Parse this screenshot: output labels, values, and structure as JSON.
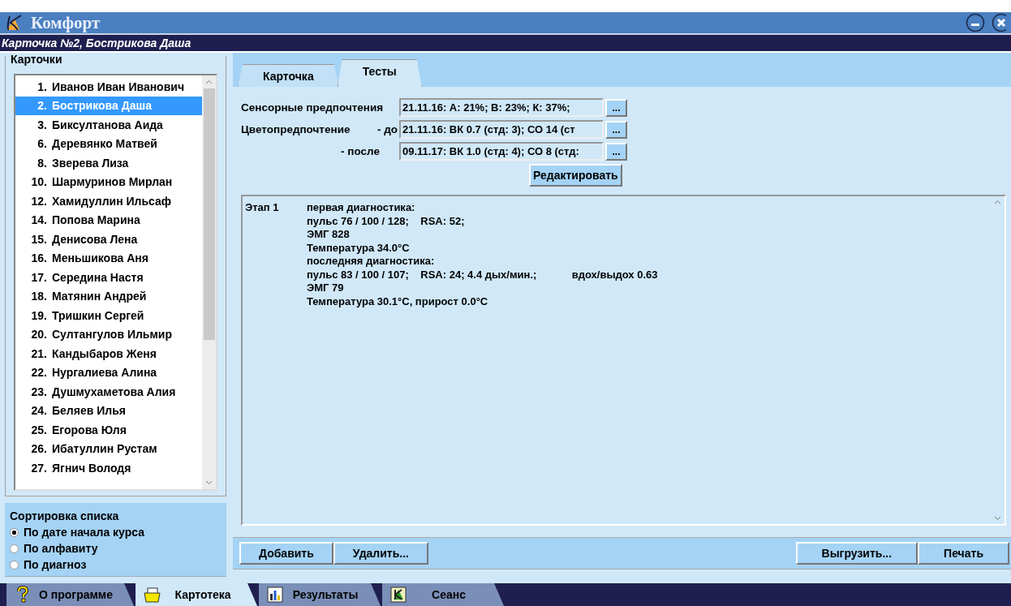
{
  "window": {
    "title": "Комфорт",
    "controls": [
      {
        "kind": "minimize"
      },
      {
        "kind": "close"
      }
    ]
  },
  "card_header": "Карточка №2, Бострикова Даша",
  "cards_panel": {
    "title": "Карточки",
    "items": [
      {
        "number": "1.",
        "name": "Иванов Иван Иванович",
        "selected": false
      },
      {
        "number": "2.",
        "name": "Бострикова Даша",
        "selected": true
      },
      {
        "number": "3.",
        "name": "Биксултанова Аида",
        "selected": false
      },
      {
        "number": "6.",
        "name": "Деревянко Матвей",
        "selected": false
      },
      {
        "number": "8.",
        "name": "Зверева Лиза",
        "selected": false
      },
      {
        "number": "10.",
        "name": "Шармуринов Мирлан",
        "selected": false
      },
      {
        "number": "12.",
        "name": "Хамидуллин Ильсаф",
        "selected": false
      },
      {
        "number": "14.",
        "name": "Попова Марина",
        "selected": false
      },
      {
        "number": "15.",
        "name": "Денисова Лена",
        "selected": false
      },
      {
        "number": "16.",
        "name": "Меньшикова Аня",
        "selected": false
      },
      {
        "number": "17.",
        "name": "Середина Настя",
        "selected": false
      },
      {
        "number": "18.",
        "name": "Матянин Андрей",
        "selected": false
      },
      {
        "number": "19.",
        "name": "Тришкин Сергей",
        "selected": false
      },
      {
        "number": "20.",
        "name": "Султангулов Ильмир",
        "selected": false
      },
      {
        "number": "21.",
        "name": "Кандыбаров Женя",
        "selected": false
      },
      {
        "number": "22.",
        "name": "Нургалиева Алина",
        "selected": false
      },
      {
        "number": "23.",
        "name": "Душмухаметова Алия",
        "selected": false
      },
      {
        "number": "24.",
        "name": "Беляев Илья",
        "selected": false
      },
      {
        "number": "25.",
        "name": "Егорова Юля",
        "selected": false
      },
      {
        "number": "26.",
        "name": "Ибатуллин Рустам",
        "selected": false
      },
      {
        "number": "27.",
        "name": "Ягнич Володя",
        "selected": false
      }
    ]
  },
  "sort": {
    "title": "Сортировка списка",
    "options": [
      {
        "label": "По дате начала курса",
        "selected": true
      },
      {
        "label": "По алфавиту",
        "selected": false
      },
      {
        "label": "По диагноз",
        "selected": false
      }
    ]
  },
  "tabs": [
    {
      "label": "Карточка",
      "selected": false
    },
    {
      "label": "Тесты",
      "selected": true
    }
  ],
  "tests": {
    "rows": [
      {
        "label": "Сенсорные предпочтения",
        "value": "21.11.16: А: 21%; В: 23%; К: 37%;",
        "button": "..."
      },
      {
        "label": "Цветопредпочтение",
        "sublabel": "- до",
        "value": "21.11.16: ВК 0.7 (стд: 3); СО 14 (ст",
        "button": "..."
      },
      {
        "sublabel": "- после",
        "value": "09.11.17: ВК 1.0 (стд: 4); СО 8 (стд:",
        "button": "..."
      }
    ],
    "edit_button": "Редактировать"
  },
  "stages": [
    {
      "label": "Этап 1",
      "lines": [
        "первая диагностика:",
        "пульс 76 / 100 / 128;    RSA: 52;",
        "ЭМГ 828",
        "Температура 34.0°C",
        "последняя диагностика:",
        "пульс 83 / 100 / 107;    RSA: 24; 4.4 дых/мин.;            вдох/выдох 0.63",
        "ЭМГ 79",
        "Температура 30.1°C, прирост 0.0°C"
      ]
    }
  ],
  "actions": {
    "left": [
      "Добавить",
      "Удалить..."
    ],
    "right": [
      "Выгрузить...",
      "Печать"
    ]
  },
  "bottom_tabs": [
    {
      "label": "О программе",
      "selected": false
    },
    {
      "label": "Картотека",
      "selected": true
    },
    {
      "label": "Результаты",
      "selected": false
    },
    {
      "label": "Сеанс",
      "selected": false
    }
  ]
}
